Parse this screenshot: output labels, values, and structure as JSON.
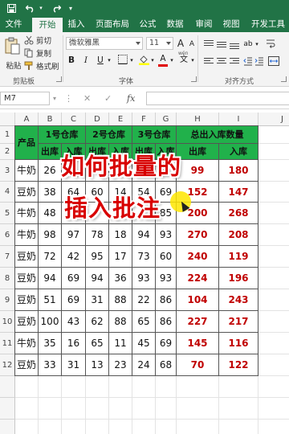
{
  "quick_access": {
    "save_icon": "save-icon",
    "undo_icon": "undo-icon",
    "redo_icon": "redo-icon",
    "customize_icon": "chevron-down-icon"
  },
  "tabs": [
    "文件",
    "开始",
    "插入",
    "页面布局",
    "公式",
    "数据",
    "审阅",
    "视图",
    "开发工具"
  ],
  "ribbon": {
    "paste": "粘贴",
    "cut": "剪切",
    "copy": "复制",
    "format_painter": "格式刷",
    "clipboard_group": "剪贴板",
    "font_name": "微软雅黑",
    "font_size": "11",
    "grow_font": "A",
    "shrink_font": "A",
    "bold": "B",
    "italic": "I",
    "underline": "U",
    "font_color_letter": "A",
    "font_group": "字体",
    "wen": "wén",
    "align_group": "对齐方式"
  },
  "formula_bar": {
    "name_box": "M7",
    "cancel": "✕",
    "enter": "✓",
    "fx": "fx",
    "value": ""
  },
  "columns": [
    "A",
    "B",
    "C",
    "D",
    "E",
    "F",
    "G",
    "H",
    "I",
    "J"
  ],
  "rows": [
    "1",
    "2",
    "3",
    "4",
    "5",
    "6",
    "7",
    "8",
    "9",
    "10",
    "11",
    "12"
  ],
  "table": {
    "product_header": "产品",
    "warehouse_1": "1号仓库",
    "warehouse_2": "2号仓库",
    "warehouse_3": "3号仓库",
    "total_header": "总出入库数量",
    "out_label": "出库",
    "in_label": "入库",
    "data": [
      [
        "牛奶",
        "26",
        "",
        "",
        "",
        "",
        "",
        "99",
        "180"
      ],
      [
        "豆奶",
        "38",
        "64",
        "60",
        "14",
        "54",
        "69",
        "152",
        "147"
      ],
      [
        "牛奶",
        "48",
        "",
        "",
        "",
        "",
        "85",
        "200",
        "268"
      ],
      [
        "牛奶",
        "98",
        "97",
        "78",
        "18",
        "94",
        "93",
        "270",
        "208"
      ],
      [
        "豆奶",
        "72",
        "42",
        "95",
        "17",
        "73",
        "60",
        "240",
        "119"
      ],
      [
        "豆奶",
        "94",
        "69",
        "94",
        "36",
        "93",
        "93",
        "224",
        "196"
      ],
      [
        "豆奶",
        "51",
        "69",
        "31",
        "88",
        "22",
        "86",
        "104",
        "243"
      ],
      [
        "豆奶",
        "100",
        "43",
        "62",
        "88",
        "65",
        "86",
        "227",
        "217"
      ],
      [
        "牛奶",
        "35",
        "16",
        "65",
        "11",
        "45",
        "69",
        "145",
        "116"
      ],
      [
        "豆奶",
        "33",
        "31",
        "13",
        "23",
        "24",
        "68",
        "70",
        "122"
      ]
    ]
  },
  "overlay": {
    "line1": "如何批量的",
    "line2": "插入批注"
  },
  "colors": {
    "excel_green": "#217346",
    "header_green": "#21b14b",
    "value_red": "#c00000",
    "overlay_red": "#d80000"
  }
}
